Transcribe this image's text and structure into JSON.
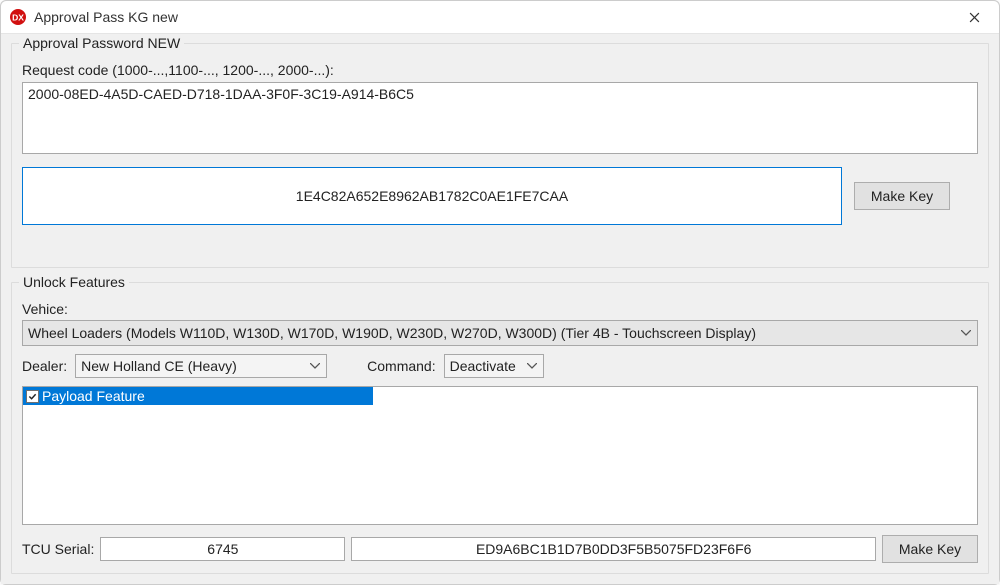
{
  "window": {
    "title": "Approval Pass KG new"
  },
  "group1": {
    "legend": "Approval Password NEW",
    "request_label": "Request code (1000-...,1100-..., 1200-..., 2000-...):",
    "request_value": "2000-08ED-4A5D-CAED-D718-1DAA-3F0F-3C19-A914-B6C5",
    "key_result": "1E4C82A652E8962AB1782C0AE1FE7CAA",
    "make_key_label": "Make Key"
  },
  "group2": {
    "legend": "Unlock Features",
    "vehicle_label": "Vehice:",
    "vehicle_value": "Wheel Loaders (Models W110D, W130D, W170D, W190D, W230D, W270D, W300D)  (Tier 4B - Touchscreen Display)",
    "dealer_label": "Dealer:",
    "dealer_value": "New Holland CE (Heavy)",
    "command_label": "Command:",
    "command_value": "Deactivate",
    "list_item_label": "Payload Feature",
    "tcu_label": "TCU Serial:",
    "tcu_value": "6745",
    "output_value": "ED9A6BC1B1D7B0DD3F5B5075FD23F6F6",
    "make_key_label": "Make Key"
  }
}
